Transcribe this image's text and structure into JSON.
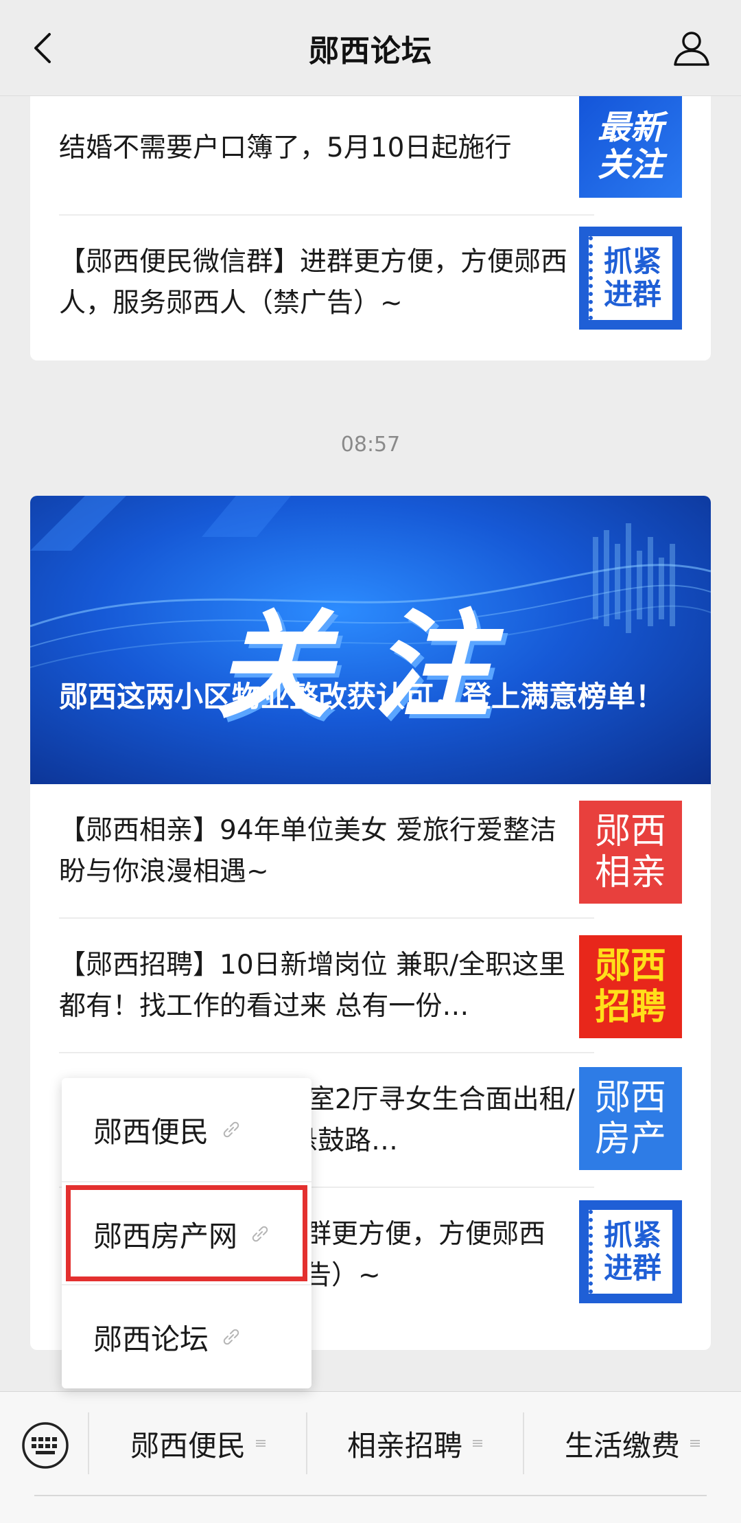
{
  "header": {
    "title": "郧西论坛"
  },
  "card1": {
    "rows": [
      {
        "text": "结婚不需要户口簿了，5月10日起施行",
        "thumb": "最新\n关注"
      },
      {
        "text": "【郧西便民微信群】进群更方便，方便郧西人，服务郧西人（禁广告）~",
        "thumb": "抓紧\n进群"
      }
    ]
  },
  "timestamp": "08:57",
  "card2": {
    "banner": {
      "big_text": "关注",
      "headline": "郧西这两小区物业整改获认可，登上满意榜单！"
    },
    "rows": [
      {
        "text": "【郧西相亲】94年单位美女 爱旅行爱整洁 盼与你浪漫相遇~",
        "thumb": "郧西\n相亲"
      },
      {
        "text": "【郧西招聘】10日新增岗位 兼职/全职这里都有！找工作的看过来 总有一份…",
        "thumb": "郧西\n招聘"
      },
      {
        "text": "3室2厅寻女生合面出租/悬鼓路…",
        "thumb": "郧西\n房产"
      },
      {
        "text": "群更方便，方便郧西告）~",
        "thumb": "抓紧\n进群"
      }
    ]
  },
  "popup": {
    "items": [
      {
        "label": "郧西便民"
      },
      {
        "label": "郧西房产网"
      },
      {
        "label": "郧西论坛"
      }
    ]
  },
  "bottom_bar": {
    "tabs": [
      {
        "label": "郧西便民"
      },
      {
        "label": "相亲招聘"
      },
      {
        "label": "生活缴费"
      }
    ]
  },
  "colors": {
    "accent_red": "#e3302f",
    "thumb_blue": "#1f5fd6",
    "bg": "#ededed"
  }
}
